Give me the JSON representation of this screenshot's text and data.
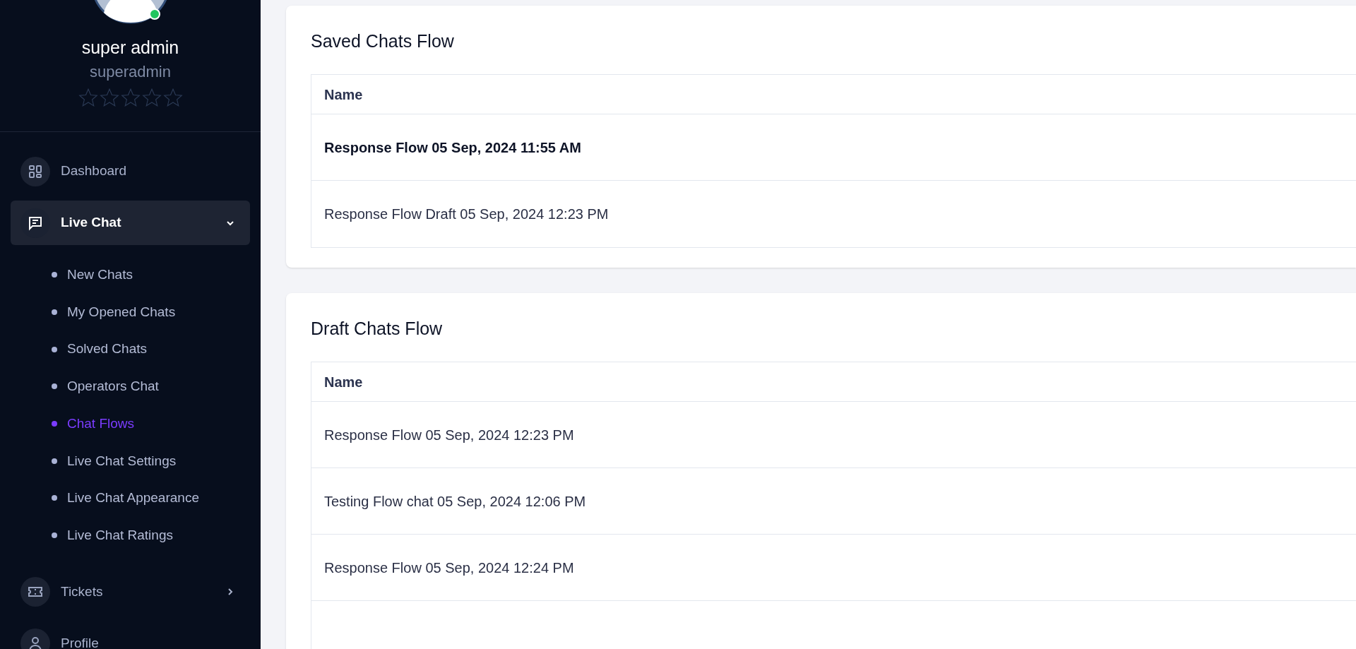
{
  "user": {
    "name": "super admin",
    "username": "superadmin",
    "online": true,
    "stars": 0
  },
  "sidebar": {
    "items": [
      {
        "label": "Dashboard",
        "kind": "link",
        "selected": false
      },
      {
        "label": "Live Chat",
        "kind": "group",
        "selected": true,
        "expanded": true,
        "children": [
          {
            "label": "New Chats",
            "selected": false
          },
          {
            "label": "My Opened Chats",
            "selected": false
          },
          {
            "label": "Solved Chats",
            "selected": false
          },
          {
            "label": "Operators Chat",
            "selected": false
          },
          {
            "label": "Chat Flows",
            "selected": true
          },
          {
            "label": "Live Chat Settings",
            "selected": false
          },
          {
            "label": "Live Chat Appearance",
            "selected": false
          },
          {
            "label": "Live Chat Ratings",
            "selected": false
          }
        ]
      },
      {
        "label": "Tickets",
        "kind": "group",
        "selected": false,
        "expanded": false
      },
      {
        "label": "Profile",
        "kind": "link",
        "selected": false
      }
    ]
  },
  "cards": [
    {
      "title": "Saved Chats Flow",
      "columns": [
        "Name"
      ],
      "rows": [
        {
          "name": "Response Flow 05 Sep, 2024 11:55 AM",
          "selected": true
        },
        {
          "name": "Response Flow Draft 05 Sep, 2024 12:23 PM",
          "selected": false
        }
      ]
    },
    {
      "title": "Draft Chats Flow",
      "columns": [
        "Name"
      ],
      "rows": [
        {
          "name": "Response Flow 05 Sep, 2024 12:23 PM",
          "selected": false
        },
        {
          "name": "Testing Flow chat 05 Sep, 2024 12:06 PM",
          "selected": false
        },
        {
          "name": "Response Flow 05 Sep, 2024 12:24 PM",
          "selected": false
        }
      ]
    }
  ]
}
